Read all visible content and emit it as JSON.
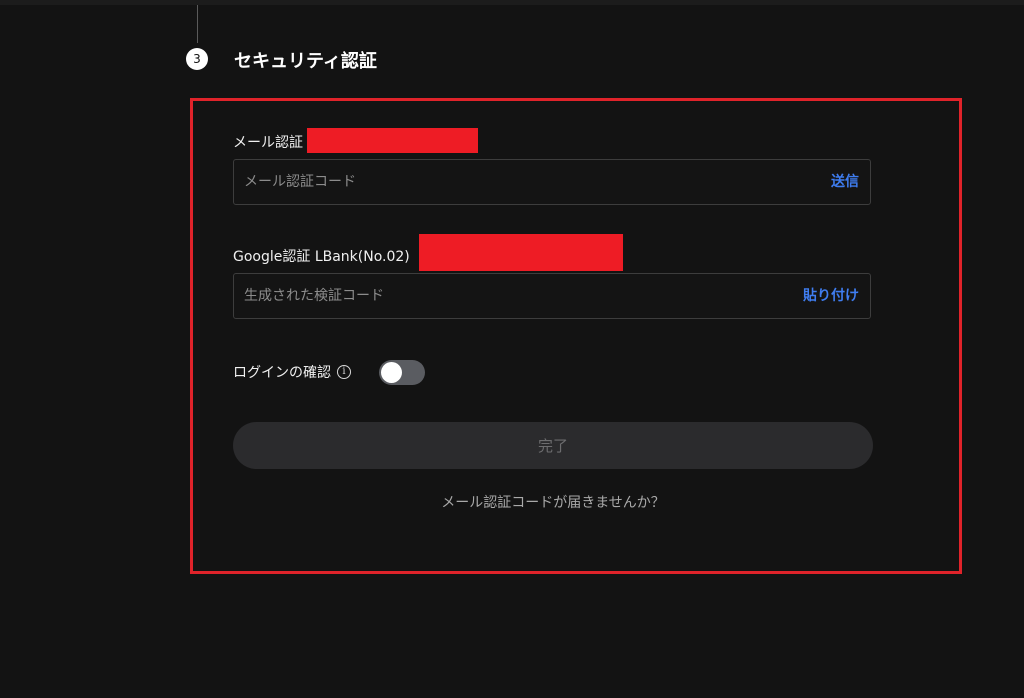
{
  "step": {
    "number": "3",
    "title": "セキュリティ認証"
  },
  "email_verification": {
    "label": "メール認証",
    "placeholder": "メール認証コード",
    "action_label": "送信"
  },
  "google_verification": {
    "label": "Google認証 LBank(No.02)",
    "placeholder": "生成された検証コード",
    "action_label": "貼り付け"
  },
  "login_confirm": {
    "label": "ログインの確認",
    "info_icon": "info-icon",
    "toggle_on": false
  },
  "submit": {
    "label": "完了"
  },
  "help": {
    "label": "メール認証コードが届きませんか？"
  },
  "colors": {
    "background": "#131313",
    "accent_link": "#3f7df0",
    "highlight_frame": "#e0232a",
    "redaction": "#ee1c25"
  }
}
